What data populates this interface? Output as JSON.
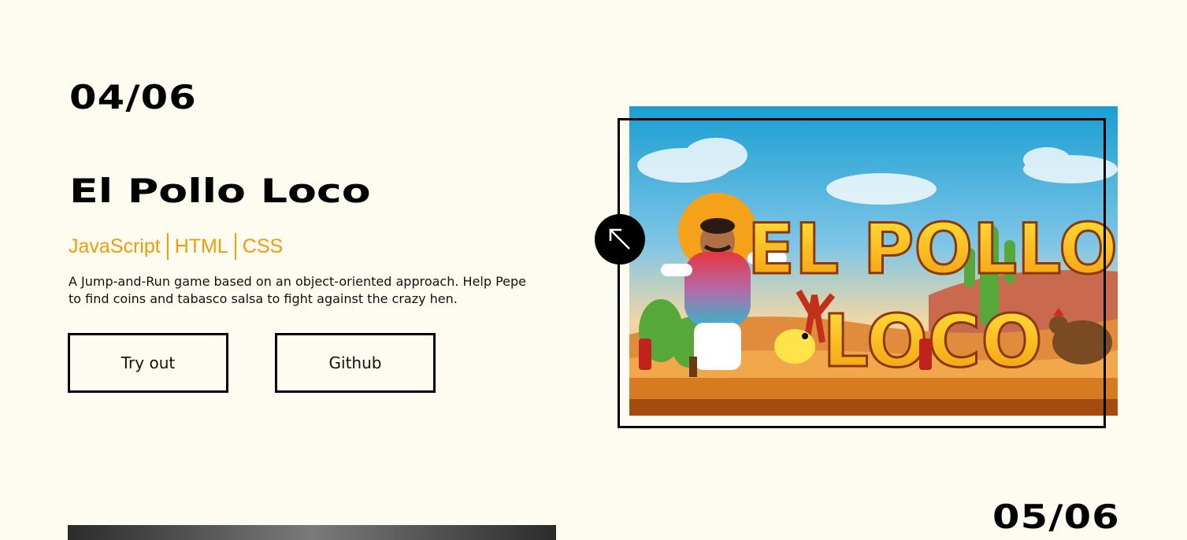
{
  "project": {
    "counter": "04/06",
    "title": "El Pollo Loco",
    "tags": [
      "JavaScript",
      "HTML",
      "CSS"
    ],
    "description": "A Jump-and-Run game based on an object-oriented approach. Help Pepe to find coins and tabasco salsa to fight against the crazy hen.",
    "buttons": {
      "try_out": "Try out",
      "github": "Github"
    },
    "image": {
      "title_line1": "EL POLLO",
      "title_line2": "LOCO"
    },
    "open_icon": "arrow-up-left-icon"
  },
  "next_project": {
    "counter": "05/06"
  },
  "colors": {
    "background": "#fefbf0",
    "accent": "#f29b0c",
    "text": "#000000"
  }
}
